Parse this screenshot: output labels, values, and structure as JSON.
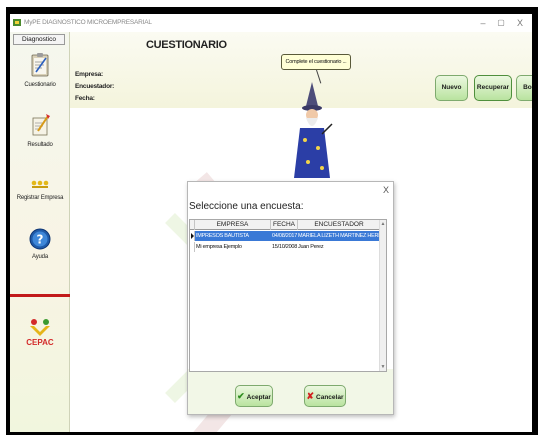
{
  "window": {
    "title": "MyPE DIAGNOSTICO MICROEMPRESARIAL",
    "controls": {
      "minimize": "–",
      "maximize": "▢",
      "close": "X"
    }
  },
  "sidebar": {
    "tab_label": "Diagnostico",
    "items": [
      {
        "label": "Cuestionario",
        "icon": "clipboard-icon"
      },
      {
        "label": "Resultado",
        "icon": "results-icon"
      },
      {
        "label": "Registrar Empresa",
        "icon": "people-icon"
      },
      {
        "label": "Ayuda",
        "icon": "help-icon"
      }
    ],
    "logo_text": "CEPAC"
  },
  "header": {
    "title": "CUESTIONARIO",
    "fields": {
      "empresa": "Empresa:",
      "encuestador": "Encuestador:",
      "fecha": "Fecha:"
    },
    "assistant_bubble": "Complete el cuestionario ..."
  },
  "toolbar": {
    "nuevo": "Nuevo",
    "recuperar": "Recuperar",
    "borrar": "Borrar"
  },
  "dialog": {
    "close": "X",
    "title": "Seleccione una encuesta:",
    "columns": [
      "EMPRESA",
      "FECHA",
      "ENCUESTADOR"
    ],
    "rows": [
      {
        "empresa": "IMPRESOS BAUTISTA",
        "fecha": "04/08/2017",
        "encuestador": "MARIELA LIZETH MARTINEZ HERNANDEZ",
        "selected": true
      },
      {
        "empresa": "Mi empresa Ejemplo",
        "fecha": "15/10/2008",
        "encuestador": "Juan Perez",
        "selected": false
      }
    ],
    "accept_label": "Aceptar",
    "cancel_label": "Cancelar"
  },
  "colors": {
    "accent_green": "#b9e39f",
    "selection_blue": "#3a79d6",
    "sidebar_divider": "#c21a1a"
  }
}
